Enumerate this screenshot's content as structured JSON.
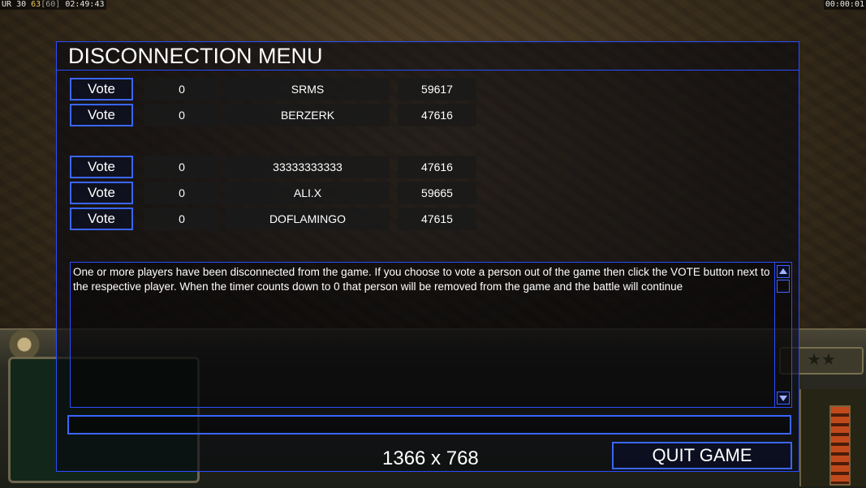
{
  "status_bar": {
    "fps_label": "UR",
    "fps_value": "30",
    "fps_secondary": "63",
    "fps_limit": "[60]",
    "clock": "02:49:43",
    "elapsed": "00:00:01"
  },
  "dialog": {
    "title": "DISCONNECTION MENU",
    "players_top": [
      {
        "vote_label": "Vote",
        "votes": "0",
        "name": "SRMS",
        "ping": "59617"
      },
      {
        "vote_label": "Vote",
        "votes": "0",
        "name": "BERZERK",
        "ping": "47616"
      }
    ],
    "players_bottom": [
      {
        "vote_label": "Vote",
        "votes": "0",
        "name": "33333333333",
        "ping": "47616"
      },
      {
        "vote_label": "Vote",
        "votes": "0",
        "name": "ALI.X",
        "ping": "59665"
      },
      {
        "vote_label": "Vote",
        "votes": "0",
        "name": "DOFLAMINGO",
        "ping": "47615"
      }
    ],
    "message": "One or more players have been disconnected from the game. If you choose to vote a person out of the game then click the VOTE button next to the respective player. When the timer counts down to 0 that person will be removed from the game and the battle will continue",
    "chat_value": "",
    "resolution": "1366 x 768",
    "quit_label": "QUIT GAME"
  },
  "hud": {
    "rank_icon": "★★"
  },
  "colors": {
    "accent_border": "#2b4cff",
    "text": "#ffffff",
    "cell_bg": "#1a1a1a"
  }
}
